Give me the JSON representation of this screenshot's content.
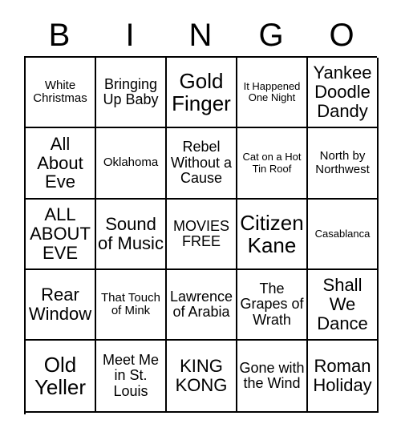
{
  "header": {
    "letters": [
      "B",
      "I",
      "N",
      "G",
      "O"
    ]
  },
  "grid": {
    "rows": [
      [
        {
          "text": "White Christmas",
          "size": "fs-sm"
        },
        {
          "text": "Bringing Up Baby",
          "size": "fs-md"
        },
        {
          "text": "Gold Finger",
          "size": "fs-xl"
        },
        {
          "text": "It Happened One Night",
          "size": "fs-xs"
        },
        {
          "text": "Yankee Doodle Dandy",
          "size": "fs-lg"
        }
      ],
      [
        {
          "text": "All About Eve",
          "size": "fs-lg"
        },
        {
          "text": "Oklahoma",
          "size": "fs-sm"
        },
        {
          "text": "Rebel Without a Cause",
          "size": "fs-md"
        },
        {
          "text": "Cat on a Hot Tin Roof",
          "size": "fs-xs"
        },
        {
          "text": "North by Northwest",
          "size": "fs-sm"
        }
      ],
      [
        {
          "text": "ALL ABOUT EVE",
          "size": "fs-lg"
        },
        {
          "text": "Sound of Music",
          "size": "fs-lg"
        },
        {
          "text": "MOVIES FREE",
          "size": "fs-md"
        },
        {
          "text": "Citizen Kane",
          "size": "fs-xl"
        },
        {
          "text": "Casablanca",
          "size": "fs-xs"
        }
      ],
      [
        {
          "text": "Rear Window",
          "size": "fs-lg"
        },
        {
          "text": "That Touch of Mink",
          "size": "fs-sm"
        },
        {
          "text": "Lawrence of Arabia",
          "size": "fs-md"
        },
        {
          "text": "The Grapes of Wrath",
          "size": "fs-md"
        },
        {
          "text": "Shall We Dance",
          "size": "fs-lg"
        }
      ],
      [
        {
          "text": "Old Yeller",
          "size": "fs-xl"
        },
        {
          "text": "Meet Me in St. Louis",
          "size": "fs-md"
        },
        {
          "text": "KING KONG",
          "size": "fs-lg"
        },
        {
          "text": "Gone with the Wind",
          "size": "fs-md"
        },
        {
          "text": "Roman Holiday",
          "size": "fs-lg"
        }
      ]
    ]
  }
}
